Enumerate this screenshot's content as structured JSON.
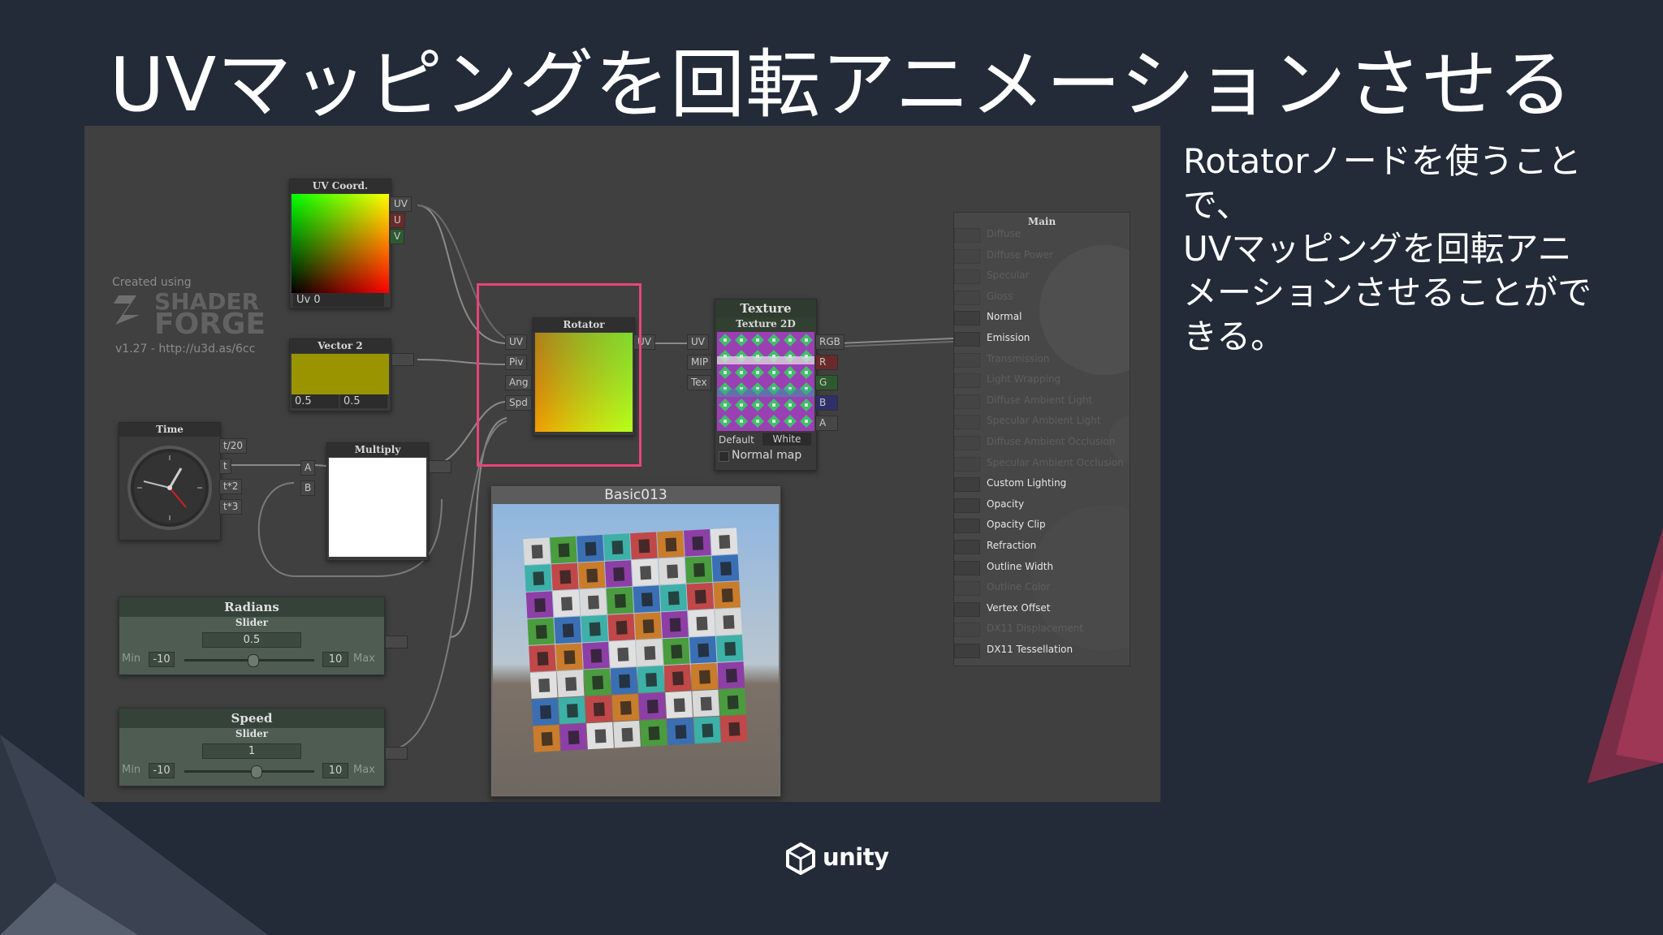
{
  "slide": {
    "title": "UVマッピングを回転アニメーションさせる",
    "description_lines": [
      "Rotatorノードを使うことで、",
      "UVマッピングを回転アニ",
      "メーションさせることがで",
      "きる。"
    ],
    "footer_logo": "unity"
  },
  "colors": {
    "background": "#232a38",
    "highlight": "#e8457a",
    "editor_bg": "#404040",
    "slider_node": "#4e5c52"
  },
  "editor": {
    "created_using": "Created using",
    "logo_top": "SHADER",
    "logo_bottom": "FORGE",
    "version": "v1.27 - http://u3d.as/6cc",
    "uv_coord": {
      "title": "UV Coord.",
      "outputs": [
        "UV",
        "U",
        "V"
      ],
      "channel": "Uv 0"
    },
    "vector2": {
      "title": "Vector 2",
      "x": "0.5",
      "y": "0.5"
    },
    "time": {
      "title": "Time",
      "outputs": [
        "t/20",
        "t",
        "t*2",
        "t*3"
      ]
    },
    "multiply": {
      "title": "Multiply",
      "inputs": [
        "A",
        "B"
      ]
    },
    "rotator": {
      "title": "Rotator",
      "inputs": [
        "UV",
        "Piv",
        "Ang",
        "Spd"
      ],
      "output": "UV"
    },
    "texture": {
      "title": "Texture",
      "subtitle": "Texture 2D",
      "inputs": [
        "UV",
        "MIP",
        "Tex"
      ],
      "outputs": [
        "RGB",
        "R",
        "G",
        "B",
        "A"
      ],
      "default_label": "Default",
      "default_value": "White",
      "normal_map": "Normal map"
    },
    "radians": {
      "title": "Radians",
      "subtitle": "Slider",
      "value": "0.5",
      "min_label": "Min",
      "min": "-10",
      "max": "10",
      "max_label": "Max",
      "level": 0.525
    },
    "speed": {
      "title": "Speed",
      "subtitle": "Slider",
      "value": "1",
      "min_label": "Min",
      "min": "-10",
      "max": "10",
      "max_label": "Max",
      "level": 0.55
    },
    "preview": {
      "title": "Basic013"
    },
    "main": {
      "title": "Main",
      "rows": [
        {
          "label": "Diffuse",
          "active": false
        },
        {
          "label": "Diffuse Power",
          "active": false
        },
        {
          "label": "Specular",
          "active": false
        },
        {
          "label": "Gloss",
          "active": false
        },
        {
          "label": "Normal",
          "active": true
        },
        {
          "label": "Emission",
          "active": true
        },
        {
          "label": "Transmission",
          "active": false
        },
        {
          "label": "Light Wrapping",
          "active": false
        },
        {
          "label": "Diffuse Ambient Light",
          "active": false
        },
        {
          "label": "Specular Ambient Light",
          "active": false
        },
        {
          "label": "Diffuse Ambient Occlusion",
          "active": false
        },
        {
          "label": "Specular Ambient Occlusion",
          "active": false
        },
        {
          "label": "Custom Lighting",
          "active": true
        },
        {
          "label": "Opacity",
          "active": true
        },
        {
          "label": "Opacity Clip",
          "active": true
        },
        {
          "label": "Refraction",
          "active": true
        },
        {
          "label": "Outline Width",
          "active": true
        },
        {
          "label": "Outline Color",
          "active": false
        },
        {
          "label": "Vertex Offset",
          "active": true
        },
        {
          "label": "DX11 Displacement",
          "active": false
        },
        {
          "label": "DX11 Tessellation",
          "active": true
        }
      ]
    }
  }
}
